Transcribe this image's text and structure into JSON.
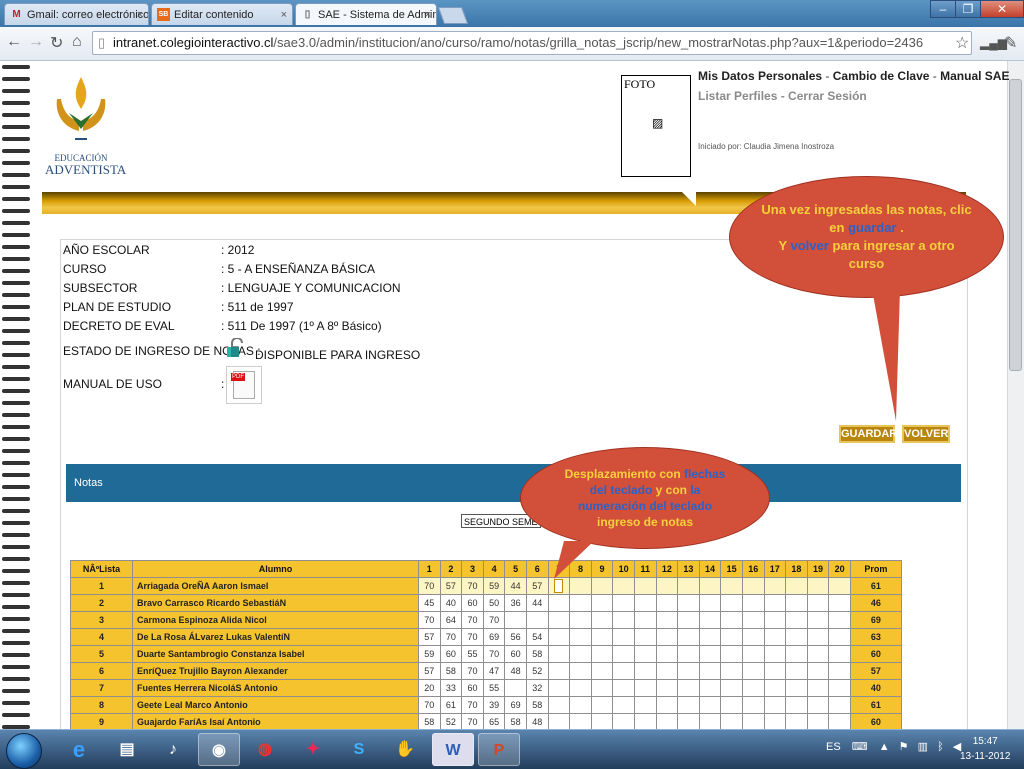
{
  "browser": {
    "tabs": [
      {
        "icon": "M",
        "title": "Gmail: correo electrónico c"
      },
      {
        "icon": "SB",
        "title": "Editar contenido"
      },
      {
        "icon": "▯",
        "title": "SAE - Sistema de Administ"
      }
    ],
    "url_host": "intranet.colegiointeractivo.cl",
    "url_path": "/sae3.0/admin/institucion/ano/curso/ramo/notas/grilla_notas_jscrip/new_mostrarNotas.php?aux=1&periodo=2436"
  },
  "header": {
    "logo_line1": "EDUCACIÓN",
    "logo_line2": "ADVENTISTA",
    "foto_label": "FOTO",
    "link_mis_datos": "Mis Datos Personales",
    "link_cambio_clave": "Cambio de Clave",
    "link_manual": "Manual SAE",
    "link_listar_perfiles": "Listar Perfiles",
    "link_cerrar_sesion": "Cerrar Sesión",
    "sep": " - ",
    "iniciado": "Iniciado por: Claudia Jimena Inostroza"
  },
  "info": {
    "ano_escolar_k": "AÑO ESCOLAR",
    "ano_escolar_v": ": 2012",
    "curso_k": "CURSO",
    "curso_v": ": 5 - A ENSEÑANZA BÁSICA",
    "subsector_k": "SUBSECTOR",
    "subsector_v": ": LENGUAJE Y COMUNICACION",
    "plan_k": "PLAN DE ESTUDIO",
    "plan_v": ": 511 de 1997",
    "decreto_k": "DECRETO DE EVAL",
    "decreto_v": ": 511 De 1997 (1º A 8º Básico)",
    "estado_k": "ESTADO DE INGRESO DE NOTAS :",
    "estado_v": "DISPONIBLE PARA INGRESO",
    "manual_k": "MANUAL DE USO",
    "manual_colon": ":"
  },
  "buttons": {
    "guardar": "GUARDAR",
    "volver": "VOLVER"
  },
  "notas_label": "Notas",
  "semestre": "SEGUNDO SEMESTRE",
  "callout_top": {
    "line1": "Una vez ingresadas las notas, clic en ",
    "guardar": "guardar",
    "line1_end": " .",
    "line2a": "Y ",
    "volver": "volver",
    "line2b": " para  ingresar a otro curso"
  },
  "callout_mid": {
    "part1": "Desplazamiento con ",
    "flechas": "flechas del teclado",
    "part2": " y con ",
    "numeracion": "la numeración del teclado",
    "part3": " ingreso de notas"
  },
  "table": {
    "h_lista": "NÂºLista",
    "h_alumno": "Alumno",
    "h_cols": [
      "1",
      "2",
      "3",
      "4",
      "5",
      "6",
      "7",
      "8",
      "9",
      "10",
      "11",
      "12",
      "13",
      "14",
      "15",
      "16",
      "17",
      "18",
      "19",
      "20"
    ],
    "h_prom": "Prom",
    "rows": [
      {
        "n": "1",
        "name": "Arriagada OreÑA Aaron Ismael",
        "g": [
          "70",
          "57",
          "70",
          "59",
          "44",
          "57"
        ],
        "prom": "61"
      },
      {
        "n": "2",
        "name": "Bravo Carrasco Ricardo SebastiáN",
        "g": [
          "45",
          "40",
          "60",
          "50",
          "36",
          "44"
        ],
        "prom": "46"
      },
      {
        "n": "3",
        "name": "Carmona Espinoza Alida Nicol",
        "g": [
          "70",
          "64",
          "70",
          "70",
          "",
          ""
        ],
        "prom": "69"
      },
      {
        "n": "4",
        "name": "De La Rosa ÁLvarez Lukas ValentíN",
        "g": [
          "57",
          "70",
          "70",
          "69",
          "56",
          "54"
        ],
        "prom": "63"
      },
      {
        "n": "5",
        "name": "Duarte Santambrogio Constanza Isabel",
        "g": [
          "59",
          "60",
          "55",
          "70",
          "60",
          "58"
        ],
        "prom": "60"
      },
      {
        "n": "6",
        "name": "EnríQuez Trujillo Bayron Alexander",
        "g": [
          "57",
          "58",
          "70",
          "47",
          "48",
          "52"
        ],
        "prom": "57"
      },
      {
        "n": "7",
        "name": "Fuentes Herrera NicoláS Antonio",
        "g": [
          "20",
          "33",
          "60",
          "55",
          "",
          "32"
        ],
        "prom": "40"
      },
      {
        "n": "8",
        "name": "Geete Leal Marco Antonio",
        "g": [
          "70",
          "61",
          "70",
          "39",
          "69",
          "58"
        ],
        "prom": "61"
      },
      {
        "n": "9",
        "name": "Guajardo FaríAs Isaí Antonio",
        "g": [
          "58",
          "52",
          "70",
          "65",
          "58",
          "48"
        ],
        "prom": "60"
      }
    ]
  },
  "taskbar": {
    "lang": "ES",
    "time": "15:47",
    "date": "13-11-2012"
  }
}
